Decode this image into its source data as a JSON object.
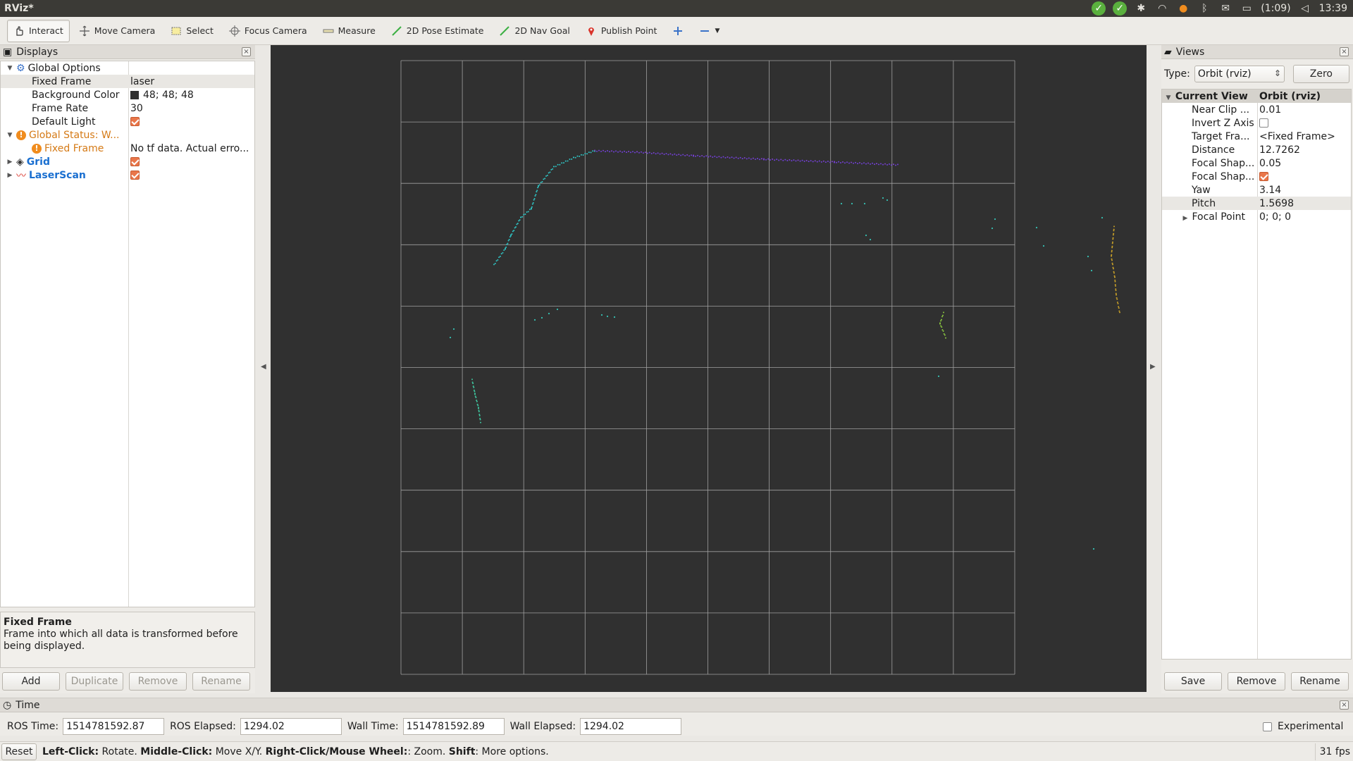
{
  "window": {
    "title": "RViz*"
  },
  "tray": {
    "battery": "(1:09)",
    "clock": "13:39"
  },
  "toolbar": {
    "interact": "Interact",
    "move_camera": "Move Camera",
    "select": "Select",
    "focus_camera": "Focus Camera",
    "measure": "Measure",
    "pose_estimate": "2D Pose Estimate",
    "nav_goal": "2D Nav Goal",
    "publish_point": "Publish Point"
  },
  "displays": {
    "title": "Displays",
    "rows": [
      {
        "label": "Global Options",
        "value": ""
      },
      {
        "label": "Fixed Frame",
        "value": "laser"
      },
      {
        "label": "Background Color",
        "value": "48; 48; 48"
      },
      {
        "label": "Frame Rate",
        "value": "30"
      },
      {
        "label": "Default Light",
        "value": ""
      },
      {
        "label": "Global Status: W...",
        "value": ""
      },
      {
        "label": "Fixed Frame",
        "value": "No tf data.  Actual erro..."
      },
      {
        "label": "Grid",
        "value": ""
      },
      {
        "label": "LaserScan",
        "value": ""
      }
    ],
    "description_title": "Fixed Frame",
    "description_text": "Frame into which all data is transformed before being displayed.",
    "buttons": {
      "add": "Add",
      "duplicate": "Duplicate",
      "remove": "Remove",
      "rename": "Rename"
    }
  },
  "views": {
    "title": "Views",
    "type_label": "Type:",
    "type_value": "Orbit (rviz)",
    "zero": "Zero",
    "header": {
      "label": "Current View",
      "value": "Orbit (rviz)"
    },
    "rows": [
      {
        "label": "Near Clip ...",
        "value": "0.01"
      },
      {
        "label": "Invert Z Axis",
        "value": ""
      },
      {
        "label": "Target Fra...",
        "value": "<Fixed Frame>"
      },
      {
        "label": "Distance",
        "value": "12.7262"
      },
      {
        "label": "Focal Shap...",
        "value": "0.05"
      },
      {
        "label": "Focal Shap...",
        "value": ""
      },
      {
        "label": "Yaw",
        "value": "3.14"
      },
      {
        "label": "Pitch",
        "value": "1.5698"
      },
      {
        "label": "Focal Point",
        "value": "0; 0; 0"
      }
    ],
    "buttons": {
      "save": "Save",
      "remove": "Remove",
      "rename": "Rename"
    }
  },
  "time": {
    "title": "Time",
    "ros_time_label": "ROS Time:",
    "ros_time": "1514781592.87",
    "ros_elapsed_label": "ROS Elapsed:",
    "ros_elapsed": "1294.02",
    "wall_time_label": "Wall Time:",
    "wall_time": "1514781592.89",
    "wall_elapsed_label": "Wall Elapsed:",
    "wall_elapsed": "1294.02",
    "experimental": "Experimental"
  },
  "status": {
    "reset": "Reset",
    "left_click": "Left-Click:",
    "left_action": " Rotate. ",
    "middle_click": "Middle-Click:",
    "middle_action": " Move X/Y. ",
    "right_click": "Right-Click/Mouse Wheel:",
    "right_action": ": Zoom. ",
    "shift": "Shift",
    "shift_action": ": More options.",
    "fps": "31 fps"
  },
  "colors": {
    "background": "#303030",
    "grid": "#a0a0a0",
    "accent": "#e9764a"
  }
}
